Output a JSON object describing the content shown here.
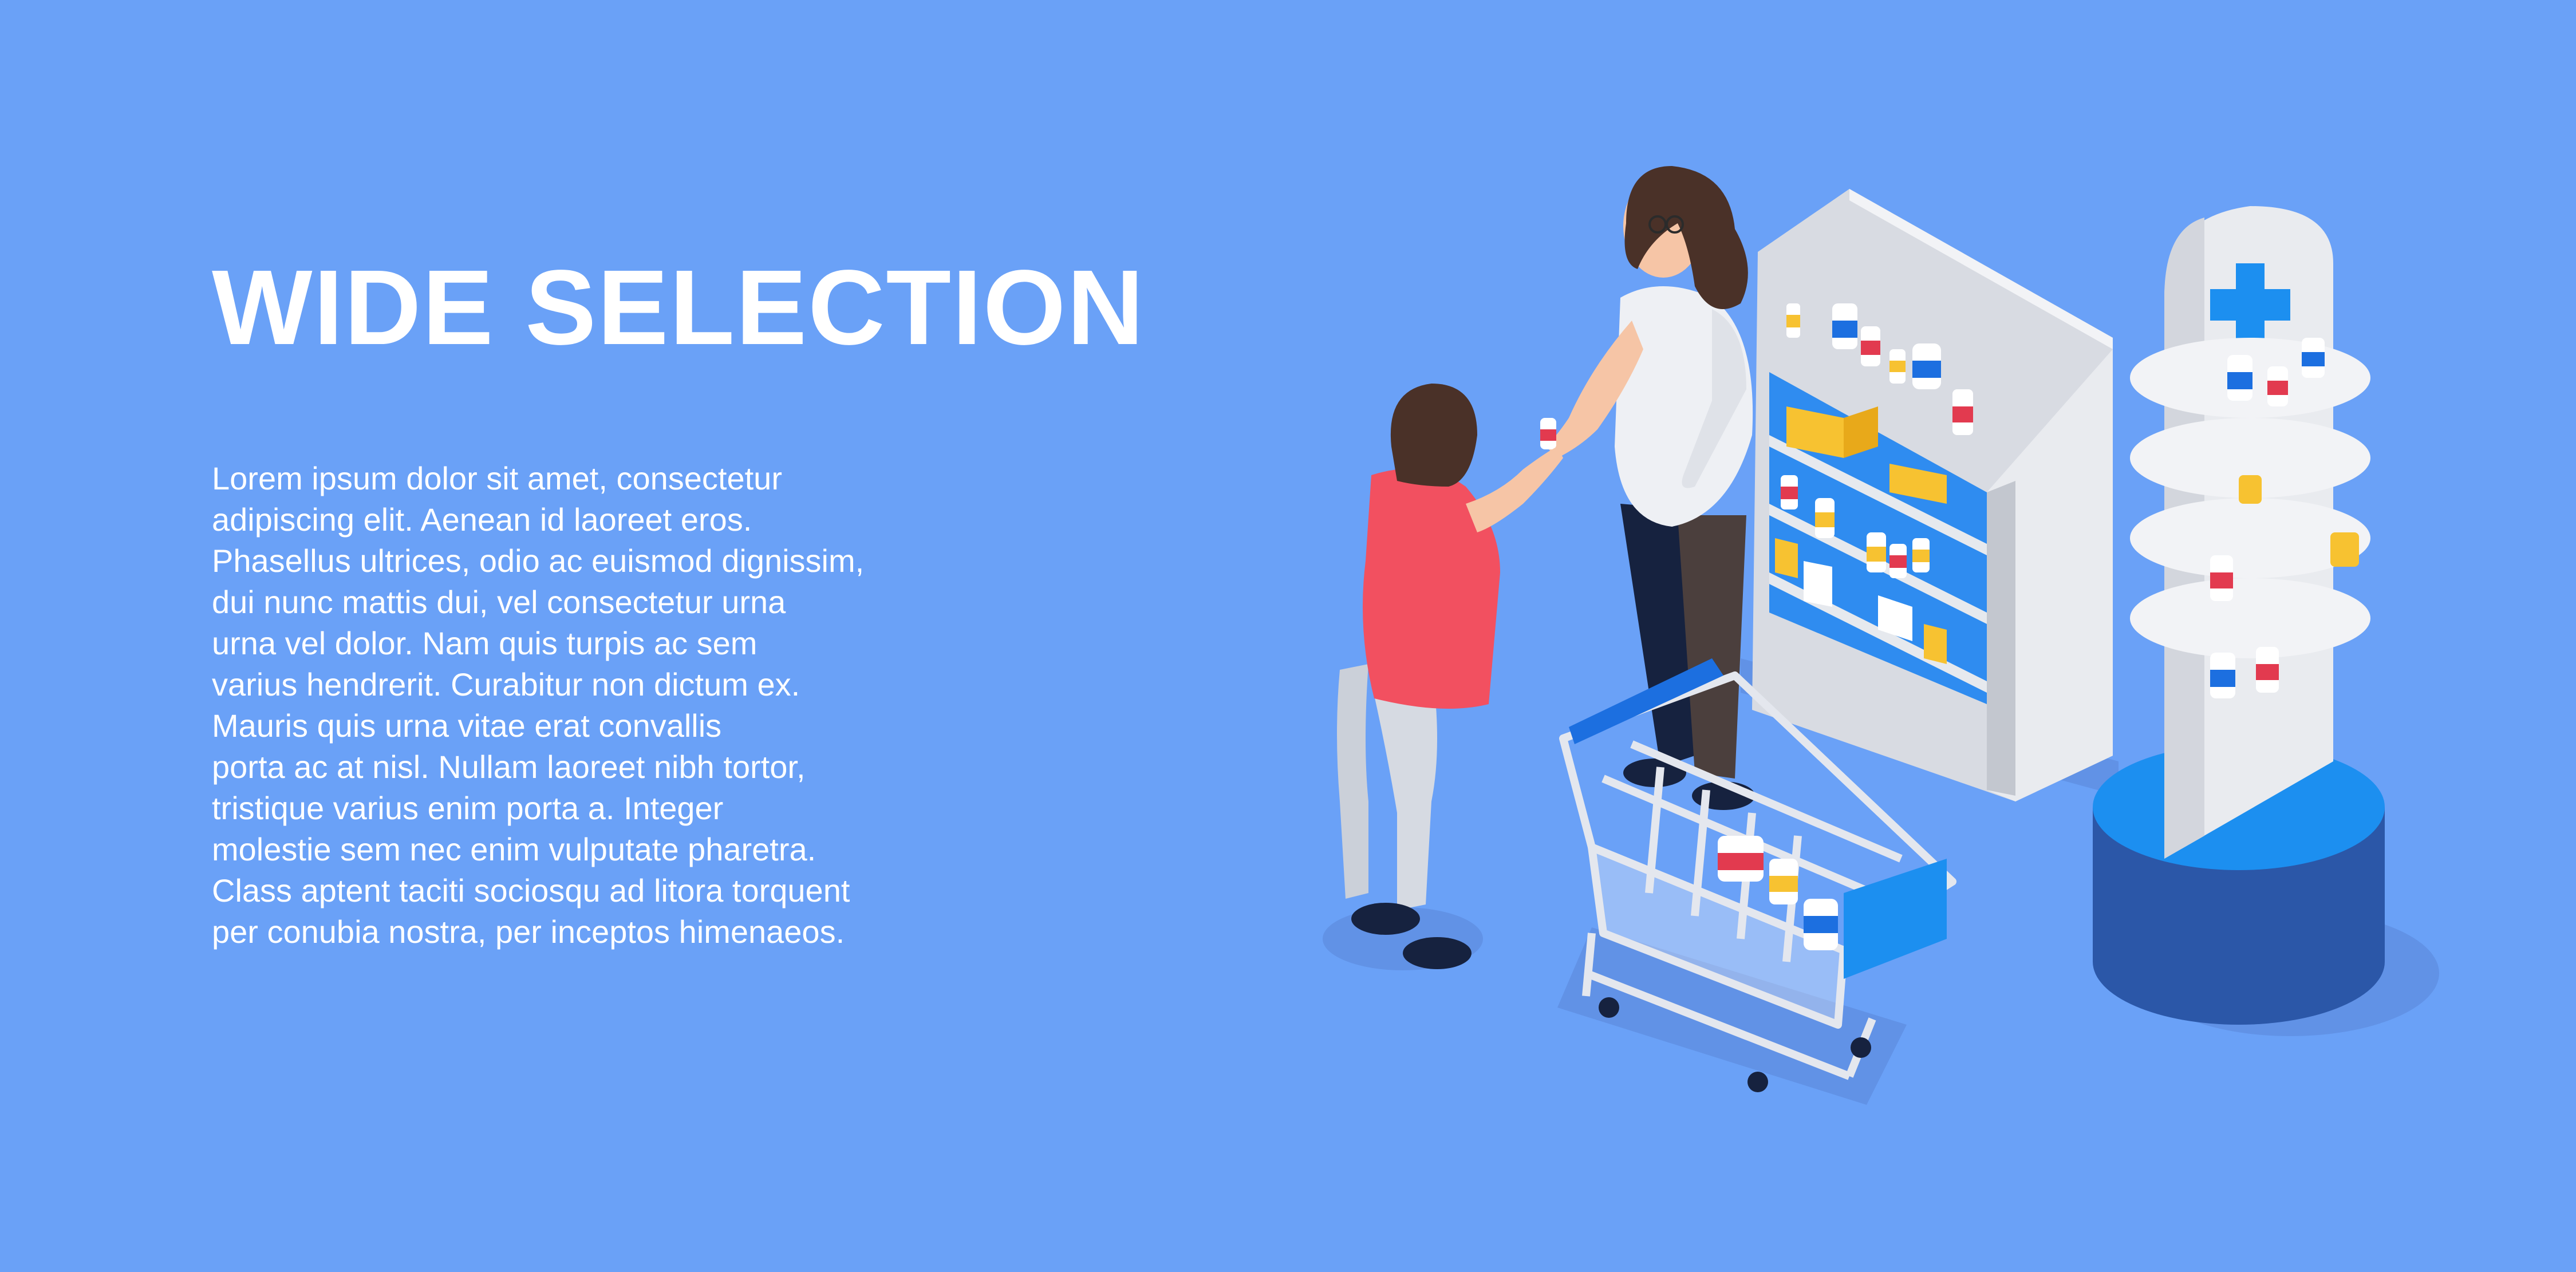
{
  "page": {
    "background_color": "#6aa1f7",
    "text_color": "#ffffff"
  },
  "hero": {
    "headline": "WIDE SELECTION",
    "body_lines": [
      "Lorem ipsum dolor sit amet, consectetur",
      "adipiscing elit. Aenean id laoreet eros.",
      "Phasellus ultrices, odio ac euismod dignissim,",
      "dui nunc mattis dui, vel consectetur urna",
      "urna vel dolor. Nam quis turpis ac sem",
      "varius hendrerit. Curabitur non dictum ex.",
      "Mauris quis urna vitae erat convallis",
      "porta ac at nisl. Nullam laoreet nibh tortor,",
      "tristique varius enim porta a. Integer",
      "molestie sem nec enim vulputate pharetra.",
      "Class aptent taciti sociosqu ad litora torquent",
      "per conubia nostra, per inceptos himenaeos."
    ]
  },
  "illustration": {
    "subject": "pharmacy-scene",
    "elements": [
      "pharmacist",
      "customer",
      "shopping-cart",
      "medicine-shelf",
      "display-stand",
      "medical-cross-icon"
    ],
    "colors": {
      "accent_blue": "#1c8ff0",
      "dark_blue": "#2b57a8",
      "shelf_white": "#eef0f4",
      "shelf_grey": "#c6c9d2",
      "shirt_red": "#f25060",
      "hair_brown": "#4a3128",
      "skin": "#f6c5a6",
      "pants_navy": "#16223f"
    }
  }
}
